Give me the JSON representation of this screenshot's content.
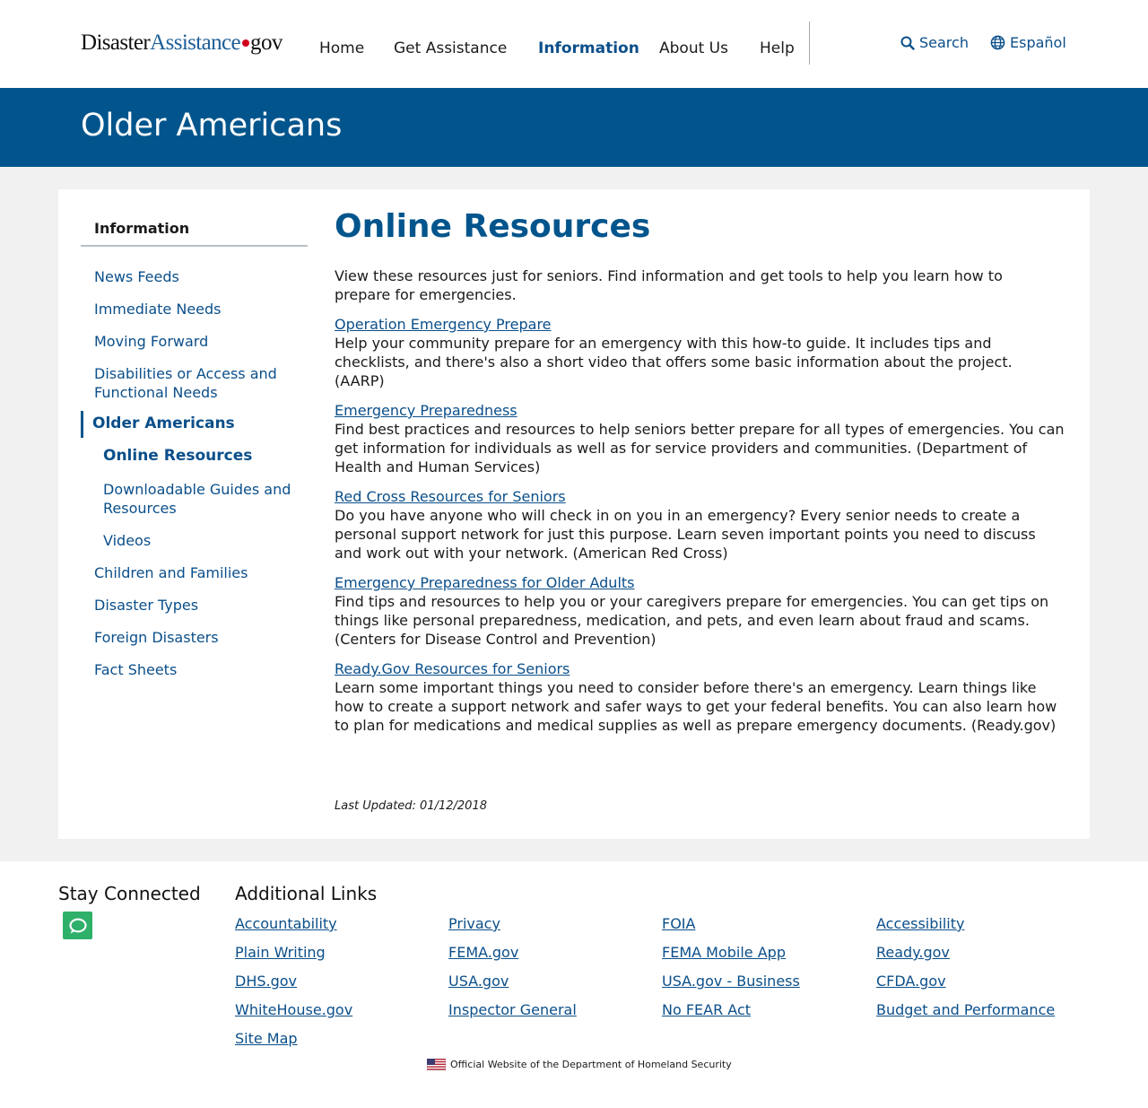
{
  "header": {
    "logo_left": "Disaster",
    "logo_mid": "Assistance",
    "logo_right": "gov",
    "nav": [
      {
        "label": "Home",
        "active": false
      },
      {
        "label": "Get Assistance",
        "active": false
      },
      {
        "label": "Information",
        "active": true
      },
      {
        "label": "About Us",
        "active": false
      },
      {
        "label": "Help",
        "active": false
      }
    ],
    "search_label": "Search",
    "language_label": "Español"
  },
  "banner": {
    "title": "Older Americans"
  },
  "sidebar": {
    "heading": "Information",
    "items": [
      {
        "label": "News Feeds"
      },
      {
        "label": "Immediate Needs"
      },
      {
        "label": "Moving Forward"
      },
      {
        "label": "Disabilities or Access and Functional Needs"
      },
      {
        "label": "Older Americans"
      },
      {
        "label": "Online Resources"
      },
      {
        "label": "Downloadable Guides and Resources"
      },
      {
        "label": "Videos"
      },
      {
        "label": "Children and Families"
      },
      {
        "label": "Disaster Types"
      },
      {
        "label": "Foreign Disasters"
      },
      {
        "label": "Fact Sheets"
      }
    ]
  },
  "main": {
    "title": "Online Resources",
    "intro": "View these resources just for seniors. Find information and get tools to help you learn how to prepare for emergencies.",
    "resources": [
      {
        "title": "Operation Emergency Prepare",
        "description": "Help your community prepare for an emergency with this how-to guide. It includes tips and checklists, and there's also a short video that offers some basic information about the project. (AARP)"
      },
      {
        "title": "Emergency Preparedness",
        "description": "Find best practices and resources to help seniors better prepare for all types of emergencies. You can get information for individuals as well as for service providers and communities. (Department of Health and Human Services)"
      },
      {
        "title": "Red Cross Resources for Seniors",
        "description": "Do you have anyone who will check in on you in an emergency? Every senior needs to create a personal support network for just this purpose. Learn seven important points you need to discuss and work out with your network. (American Red Cross)"
      },
      {
        "title": "Emergency Preparedness for Older Adults",
        "description": "Find tips and resources to help you or your caregivers prepare for emergencies. You can get tips on things like personal preparedness, medication, and pets, and even learn about fraud and scams. (Centers for Disease Control and Prevention)"
      },
      {
        "title": "Ready.Gov Resources for Seniors",
        "description": "Learn some important things you need to consider before there's an emergency. Learn things like how to create a support network and safer ways to get your federal benefits. You can also learn how to plan for medications and medical supplies as well as prepare emergency documents. (Ready.gov)"
      }
    ],
    "last_updated": "Last Updated: 01/12/2018"
  },
  "footer": {
    "stay_connected": "Stay Connected",
    "additional_links": "Additional Links",
    "links": [
      [
        "Accountability",
        "Privacy",
        "FOIA",
        "Accessibility"
      ],
      [
        "Plain Writing",
        "FEMA.gov",
        "FEMA Mobile App",
        "Ready.gov"
      ],
      [
        "DHS.gov",
        "USA.gov",
        "USA.gov - Business",
        "CFDA.gov"
      ],
      [
        "WhiteHouse.gov",
        "Inspector General",
        "No FEAR Act",
        "Budget and Performance"
      ],
      [
        "Site Map"
      ]
    ],
    "official_text": "Official Website of the Department of Homeland Security"
  },
  "colors": {
    "brand_blue": "#02558c",
    "link_blue": "#0b4f8a",
    "logo_dot_red": "#d0021b",
    "chat_green": "#2fb06a"
  },
  "icons": {
    "search": "magnifier-icon",
    "language": "globe-icon",
    "chat": "chat-bubble-icon",
    "flag": "us-flag-icon"
  }
}
